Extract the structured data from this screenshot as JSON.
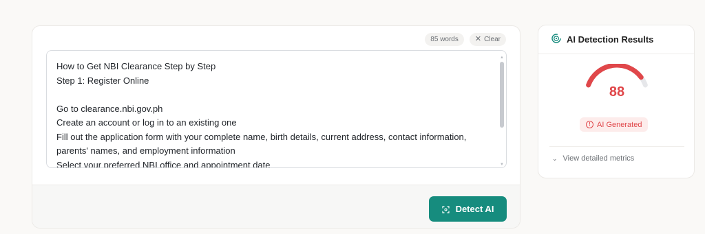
{
  "editor": {
    "word_count": "85 words",
    "clear_label": "Clear",
    "lines": [
      "How to Get NBI Clearance Step by Step",
      "Step 1: Register Online",
      "",
      "Go to clearance.nbi.gov.ph",
      "Create an account or log in to an existing one",
      "Fill out the application form with your complete name, birth details, current address, contact information,",
      "parents' names, and employment information",
      "Select your preferred NBI office and appointment date"
    ],
    "detect_label": "Detect AI",
    "icons": {
      "clear": "close-icon",
      "detect": "scan-icon"
    }
  },
  "results": {
    "title": "AI Detection Results",
    "title_icon": "target-icon",
    "score": "88",
    "score_value": 88,
    "score_max": 100,
    "verdict": "AI Generated",
    "verdict_icon": "alert-circle-icon",
    "details_label": "View detailed metrics",
    "details_icon": "chevron-down-icon"
  },
  "colors": {
    "accent": "#168c7e",
    "danger": "#e0474a",
    "gauge_track": "#e6e7ea",
    "background": "#faf9f7"
  }
}
